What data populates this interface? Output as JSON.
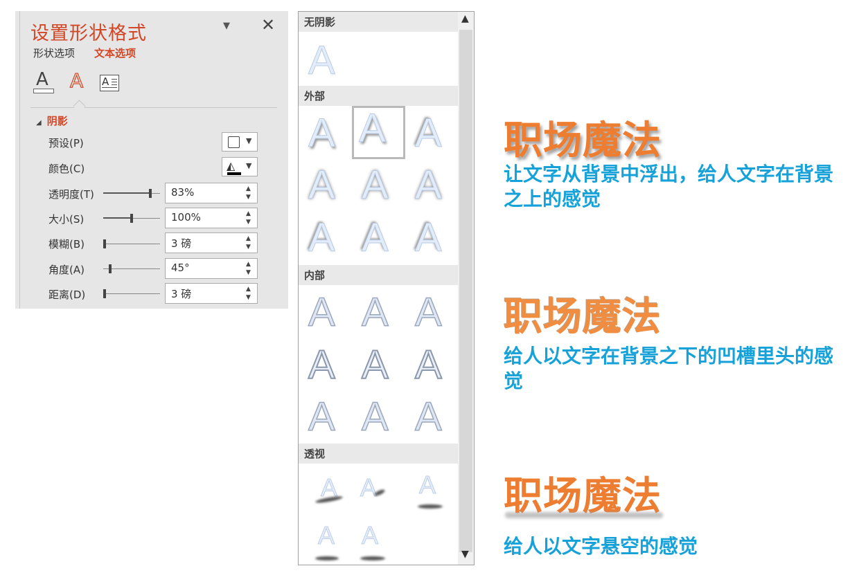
{
  "pane": {
    "title": "设置形状格式",
    "menu_icon": "▼",
    "close_icon": "✕",
    "tabs": [
      "形状选项",
      "文本选项"
    ],
    "icons": [
      "text-fill-outline-icon",
      "text-effects-icon",
      "textbox-icon"
    ],
    "icon_letter": "A",
    "section": {
      "toggle": "◢",
      "label": "阴影"
    },
    "rows": {
      "preset": {
        "label": "预设(P)"
      },
      "color": {
        "label": "颜色(C)"
      },
      "transparency": {
        "label": "透明度(T)",
        "value": "83%",
        "slider": 0.83
      },
      "size": {
        "label": "大小(S)",
        "value": "100%",
        "slider": 0.5
      },
      "blur": {
        "label": "模糊(B)",
        "value": "3 磅",
        "slider": 0.03
      },
      "angle": {
        "label": "角度(A)",
        "value": "45°",
        "slider": 0.12
      },
      "distance": {
        "label": "距离(D)",
        "value": "3 磅",
        "slider": 0.03
      }
    },
    "colors": {
      "accent": "#d24726",
      "pane_bg": "#e6e6e6"
    }
  },
  "gallery": {
    "groups": [
      "无阴影",
      "外部",
      "内部",
      "透视"
    ],
    "letter": "A",
    "scroll_up": "▲",
    "scroll_down": "▼"
  },
  "annotations": {
    "heading": "职场魔法",
    "desc_raised": "让文字从背景中浮出，给人文字在背景之上的感觉",
    "desc_sunken": "给人以文字在背景之下的凹槽里头的感觉",
    "desc_floating": "给人以文字悬空的感觉",
    "colors": {
      "heading": "#ed7d31",
      "desc": "#16a2d8"
    }
  }
}
